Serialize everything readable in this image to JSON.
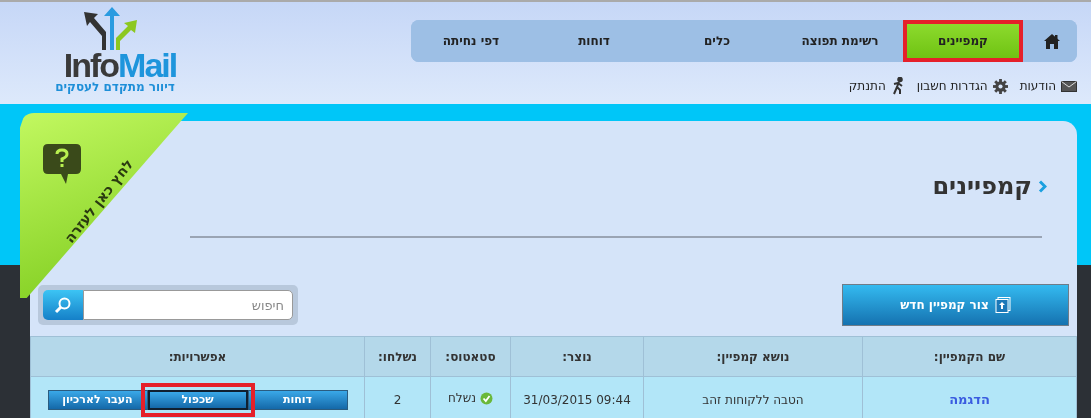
{
  "logo": {
    "name_dark": "Info",
    "name_light": "Mail",
    "tagline": "דיוור מתקדם לעסקים"
  },
  "nav": {
    "tabs": [
      {
        "label": "קמפיינים",
        "selected": true,
        "highlighted": true
      },
      {
        "label": "רשימת תפוצה",
        "selected": false,
        "highlighted": false
      },
      {
        "label": "כלים",
        "selected": false,
        "highlighted": false
      },
      {
        "label": "דוחות",
        "selected": false,
        "highlighted": false
      },
      {
        "label": "דפי נחיתה",
        "selected": false,
        "highlighted": false
      }
    ]
  },
  "account_links": [
    {
      "kind": "messages",
      "label": "הודעות"
    },
    {
      "kind": "settings",
      "label": "הגדרות חשבון"
    },
    {
      "kind": "logout",
      "label": "התנתק"
    }
  ],
  "help_ribbon": {
    "label": "לחץ כאן לעזרה"
  },
  "page_title": "קמפיינים",
  "new_campaign_button": "צור קמפיין חדש",
  "search": {
    "placeholder": "חיפוש"
  },
  "table": {
    "columns": [
      "שם הקמפיין:",
      "נושא קמפיין:",
      "נוצר:",
      "סטאטוס:",
      "נשלחו:",
      "אפשרויות:"
    ],
    "rows": [
      {
        "name": "הדגמה",
        "subject": "הטבה ללקוחות זהב",
        "created": "31/03/2015 09:44",
        "status": "נשלח",
        "status_ok": true,
        "sent": "2",
        "actions": [
          {
            "label": "דוחות",
            "highlighted": false
          },
          {
            "label": "שכפול",
            "highlighted": true
          },
          {
            "label": "העבר לארכיון",
            "highlighted": false
          }
        ]
      }
    ]
  }
}
